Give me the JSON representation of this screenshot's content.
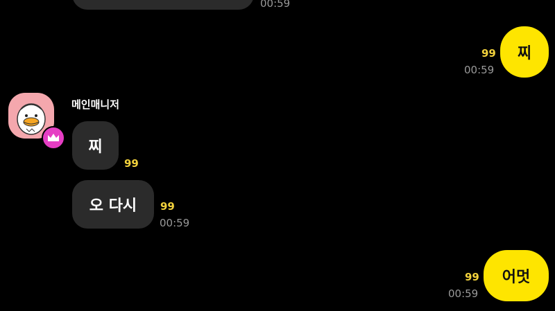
{
  "messages": {
    "top": {
      "time": "00:59"
    },
    "me1": {
      "text": "찌",
      "unread": "99",
      "time": "00:59"
    },
    "other": {
      "sender": "메인매니저",
      "msg1": {
        "text": "찌",
        "unread": "99"
      },
      "msg2": {
        "text": "오 다시",
        "unread": "99",
        "time": "00:59"
      }
    },
    "me2": {
      "text": "어멋",
      "unread": "99",
      "time": "00:59"
    }
  },
  "colors": {
    "background": "#000000",
    "my_bubble": "#fee500",
    "other_bubble": "#2b2b2b",
    "unread": "#f2d23c",
    "timestamp": "#9a9a9a",
    "crown_badge": "#e63ec4"
  },
  "icons": {
    "avatar": "duck-character-avatar",
    "badge": "crown-icon"
  }
}
